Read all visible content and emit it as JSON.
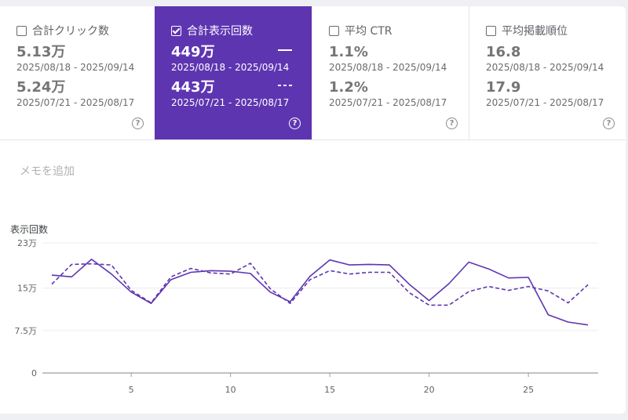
{
  "metrics": [
    {
      "label": "合計クリック数",
      "checked": false,
      "value1": "5.13万",
      "date1": "2025/08/18 - 2025/09/14",
      "value2": "5.24万",
      "date2": "2025/07/21 - 2025/08/17",
      "help": "?"
    },
    {
      "label": "合計表示回数",
      "checked": true,
      "value1": "449万",
      "date1": "2025/08/18 - 2025/09/14",
      "value2": "443万",
      "date2": "2025/07/21 - 2025/08/17",
      "help": "?"
    },
    {
      "label": "平均 CTR",
      "checked": false,
      "value1": "1.1%",
      "date1": "2025/08/18 - 2025/09/14",
      "value2": "1.2%",
      "date2": "2025/07/21 - 2025/08/17",
      "help": "?"
    },
    {
      "label": "平均掲載順位",
      "checked": false,
      "value1": "16.8",
      "date1": "2025/08/18 - 2025/09/14",
      "value2": "17.9",
      "date2": "2025/07/21 - 2025/08/17",
      "help": "?"
    }
  ],
  "memo": "メモを追加",
  "colors": {
    "accent": "#5e35b1",
    "series": "#5e35b1"
  },
  "chart_data": {
    "type": "line",
    "ylabel": "表示回数",
    "y_ticks": [
      0,
      7.5,
      15,
      23
    ],
    "y_tick_labels": [
      "0",
      "7.5万",
      "15万",
      "23万"
    ],
    "ylim": [
      0,
      23
    ],
    "xlim": [
      1,
      28
    ],
    "x_ticks": [
      5,
      10,
      15,
      20,
      25
    ],
    "x": [
      1,
      2,
      3,
      4,
      5,
      6,
      7,
      8,
      9,
      10,
      11,
      12,
      13,
      14,
      15,
      16,
      17,
      18,
      19,
      20,
      21,
      22,
      23,
      24,
      25,
      26,
      27,
      28
    ],
    "series": [
      {
        "style": "solid",
        "values": [
          17.3,
          17,
          20.1,
          17.5,
          14.3,
          12.3,
          16.5,
          17.8,
          18.1,
          18,
          17.6,
          14.3,
          12.6,
          17.1,
          20,
          19.1,
          19.2,
          19.1,
          15.7,
          12.8,
          15.8,
          19.6,
          18.4,
          16.8,
          16.9,
          10.3,
          9,
          8.5
        ]
      },
      {
        "style": "dashed",
        "values": [
          15.7,
          19.2,
          19.3,
          19.1,
          14.6,
          12.4,
          17,
          18.5,
          17.7,
          17.5,
          19.4,
          14.9,
          12.3,
          16.5,
          18.1,
          17.5,
          17.8,
          17.8,
          14.2,
          12,
          12,
          14.4,
          15.3,
          14.6,
          15.3,
          14.5,
          12.4,
          15.6
        ]
      }
    ]
  }
}
